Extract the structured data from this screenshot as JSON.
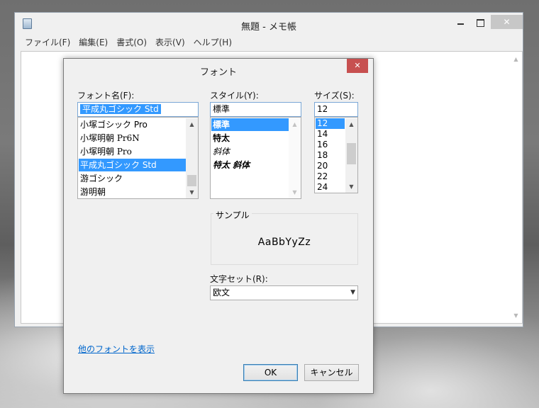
{
  "notepad": {
    "title": "無題 - メモ帳",
    "controls": {
      "close": "✕"
    },
    "menu": [
      "ファイル(F)",
      "編集(E)",
      "書式(O)",
      "表示(V)",
      "ヘルプ(H)"
    ]
  },
  "dialog": {
    "title": "フォント",
    "close": "✕",
    "font_label": "フォント名(F):",
    "font_value": "平成丸ゴシック Std",
    "font_list": [
      "小塚ゴシック Pro",
      "小塚明朝 Pr6N",
      "小塚明朝 Pro",
      "平成丸ゴシック Std",
      "游ゴシック",
      "游明朝"
    ],
    "font_selected_index": 3,
    "style_label": "スタイル(Y):",
    "style_value": "標準",
    "style_list": [
      "標準",
      "特太",
      "斜体",
      "特太 斜体"
    ],
    "style_selected_index": 0,
    "size_label": "サイズ(S):",
    "size_value": "12",
    "size_list": [
      "12",
      "14",
      "16",
      "18",
      "20",
      "22",
      "24"
    ],
    "size_selected_index": 0,
    "sample_label": "サンプル",
    "sample_text": "AaBbYyZz",
    "charset_label": "文字セット(R):",
    "charset_value": "欧文",
    "more_fonts_link": "他のフォントを表示",
    "ok_label": "OK",
    "cancel_label": "キャンセル"
  },
  "colors": {
    "selection": "#3399ff",
    "close_red": "#c75050",
    "link": "#0066cc"
  }
}
